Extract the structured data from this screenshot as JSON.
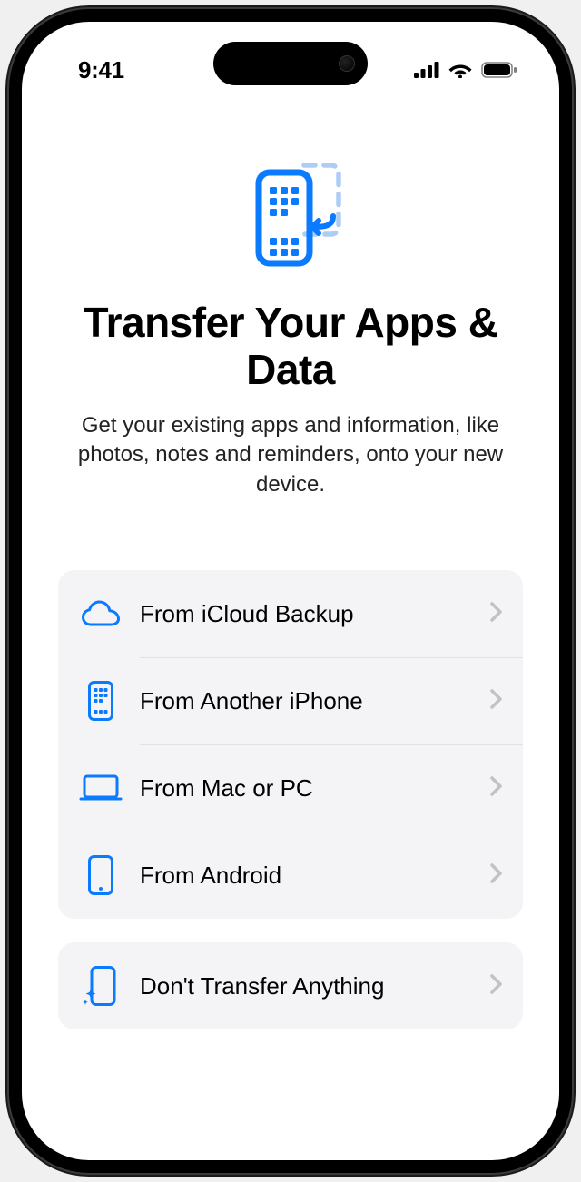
{
  "status_bar": {
    "time": "9:41"
  },
  "header": {
    "title": "Transfer Your Apps & Data",
    "subtitle": "Get your existing apps and information, like photos, notes and reminders, onto your new device."
  },
  "options": {
    "icloud_backup": "From iCloud Backup",
    "another_iphone": "From Another iPhone",
    "mac_or_pc": "From Mac or PC",
    "android": "From Android",
    "dont_transfer": "Don't Transfer Anything"
  }
}
